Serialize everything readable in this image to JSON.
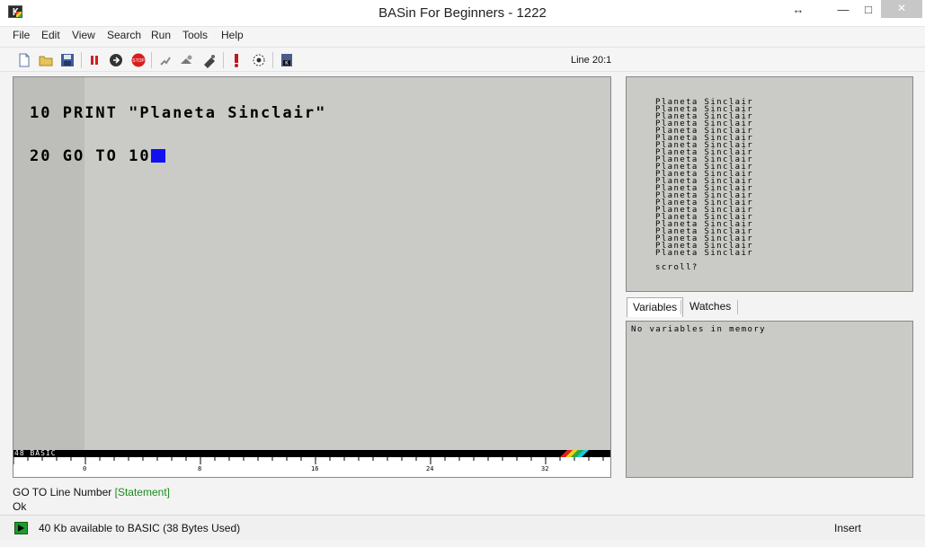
{
  "window": {
    "title": "BASin For Beginners - 1222",
    "restore_glyph": "↔",
    "minimize_glyph": "—",
    "maximize_glyph": "□",
    "close_glyph": "✕"
  },
  "menu": [
    "File",
    "Edit",
    "View",
    "Search",
    "Run",
    "Tools",
    "Help"
  ],
  "toolbar": {
    "buttons": [
      "new-file-icon",
      "open-folder-icon",
      "save-disk-icon",
      "pause-icon",
      "continue-icon",
      "stop-icon",
      "step-icon",
      "trace-icon",
      "watch-icon",
      "breakpoint-icon",
      "settings-icon",
      "spectrum-icon"
    ],
    "line_indicator": "Line 20:1"
  },
  "editor": {
    "lines": [
      {
        "number": "10",
        "text": " PRINT \"Planeta Sinclair\""
      },
      {
        "number": "20",
        "text": " GO TO 10"
      }
    ],
    "mode_label": "48 BASIC",
    "ruler_ticks": [
      "0",
      "8",
      "16",
      "24",
      "32"
    ],
    "cursor_color": "#1010f0"
  },
  "output": {
    "lines": [
      "Planeta Sinclair",
      "Planeta Sinclair",
      "Planeta Sinclair",
      "Planeta Sinclair",
      "Planeta Sinclair",
      "Planeta Sinclair",
      "Planeta Sinclair",
      "Planeta Sinclair",
      "Planeta Sinclair",
      "Planeta Sinclair",
      "Planeta Sinclair",
      "Planeta Sinclair",
      "Planeta Sinclair",
      "Planeta Sinclair",
      "Planeta Sinclair",
      "Planeta Sinclair",
      "Planeta Sinclair",
      "Planeta Sinclair",
      "Planeta Sinclair",
      "Planeta Sinclair",
      "Planeta Sinclair",
      "Planeta Sinclair"
    ],
    "prompt": "scroll?"
  },
  "tabs": {
    "variables": "Variables",
    "watches": "Watches"
  },
  "variables": {
    "empty_message": "No variables in memory"
  },
  "info": {
    "command": "GO TO Line Number",
    "kind": "[Statement]",
    "result": "Ok"
  },
  "footer": {
    "memory": "40 Kb available to BASIC (38 Bytes Used)",
    "mode": "Insert"
  }
}
